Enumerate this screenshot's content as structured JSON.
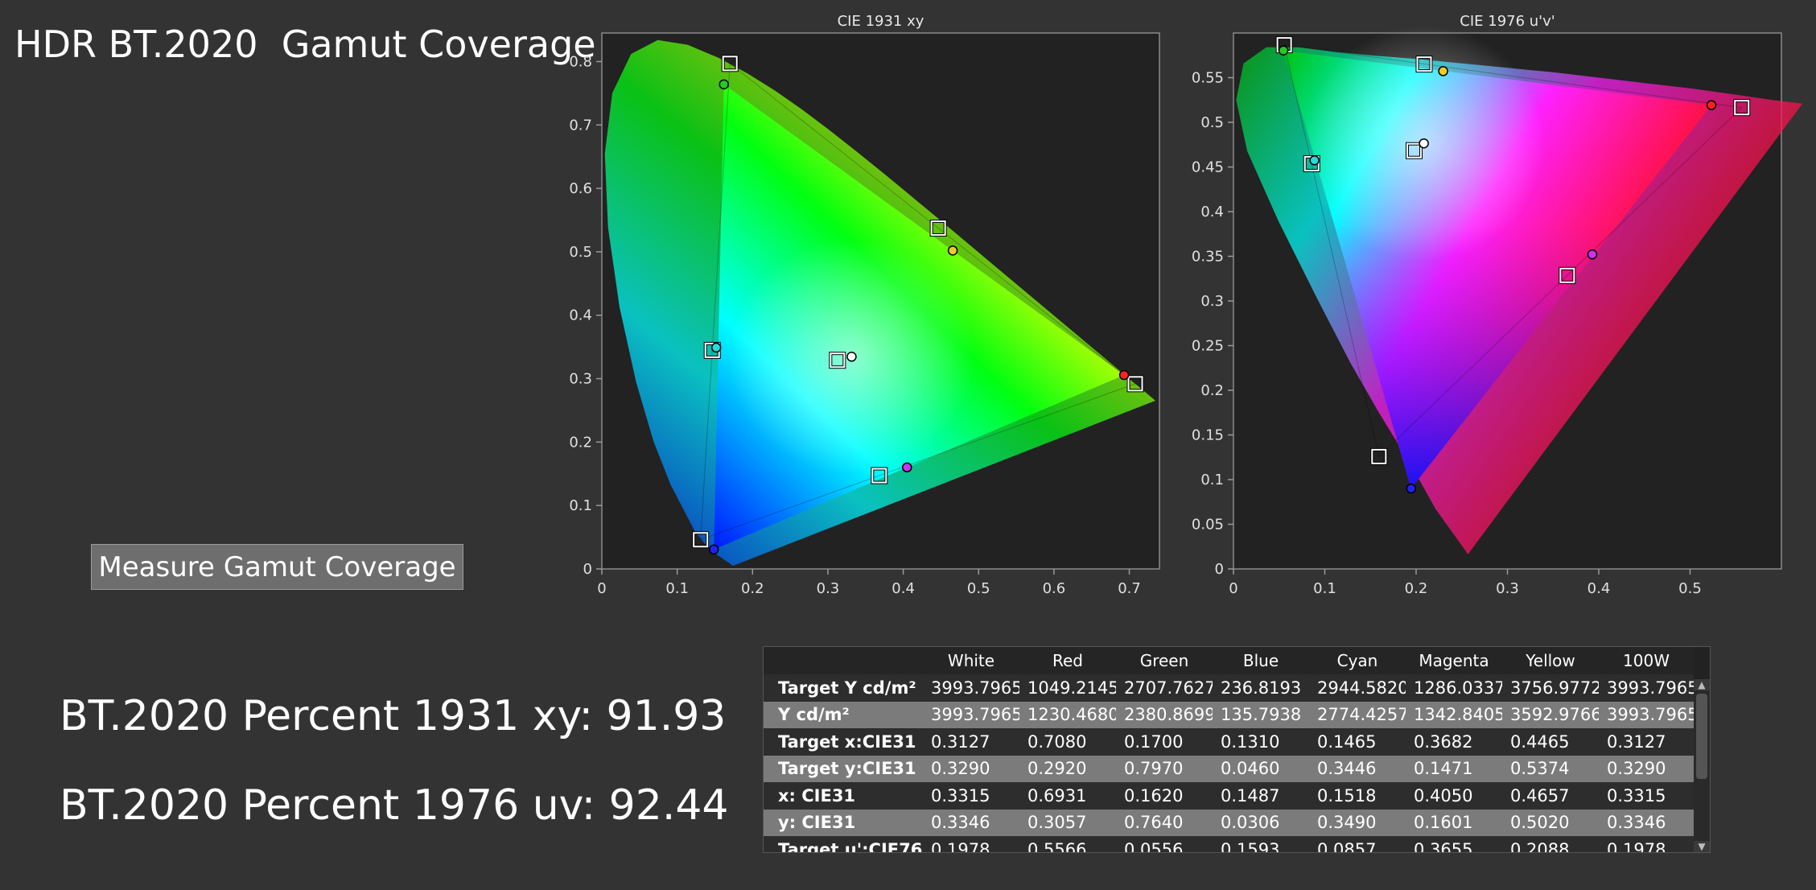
{
  "page_title": "HDR BT.2020  Gamut Coverage",
  "measure_button_label": "Measure Gamut Coverage",
  "stats": {
    "percent_1931": "BT.2020 Percent 1931 xy: 91.93",
    "percent_1976": "BT.2020 Percent 1976 uv: 92.44"
  },
  "colors": {
    "background": "#333333",
    "plot_background": "#222222",
    "table_row_alt": "#7b7b7b"
  },
  "chart_data": [
    {
      "type": "scatter",
      "title": "CIE 1931 xy",
      "xlabel": "",
      "ylabel": "",
      "xlim": [
        0,
        0.74
      ],
      "ylim": [
        0,
        0.845
      ],
      "xticks": [
        0,
        0.1,
        0.2,
        0.3,
        0.4,
        0.5,
        0.6,
        0.7
      ],
      "yticks": [
        0,
        0.1,
        0.2,
        0.3,
        0.4,
        0.5,
        0.6,
        0.7,
        0.8
      ],
      "grid": false,
      "series": [
        {
          "marker": "square",
          "points": [
            {
              "x": 0.3127,
              "y": 0.329
            },
            {
              "x": 0.708,
              "y": 0.292
            },
            {
              "x": 0.17,
              "y": 0.797
            },
            {
              "x": 0.131,
              "y": 0.046
            },
            {
              "x": 0.1465,
              "y": 0.3446
            },
            {
              "x": 0.3682,
              "y": 0.1471
            },
            {
              "x": 0.4465,
              "y": 0.5374
            }
          ]
        },
        {
          "marker": "circle",
          "points": [
            {
              "x": 0.3315,
              "y": 0.3346,
              "color": "#ffffff"
            },
            {
              "x": 0.6931,
              "y": 0.3057,
              "color": "#ff2020"
            },
            {
              "x": 0.162,
              "y": 0.764,
              "color": "#22cc22"
            },
            {
              "x": 0.1487,
              "y": 0.0306,
              "color": "#2222ee"
            },
            {
              "x": 0.1518,
              "y": 0.349,
              "color": "#22dddd"
            },
            {
              "x": 0.405,
              "y": 0.1601,
              "color": "#cc33ee"
            },
            {
              "x": 0.4657,
              "y": 0.502,
              "color": "#eecc22"
            }
          ]
        }
      ]
    },
    {
      "type": "scatter",
      "title": "CIE 1976 u'v'",
      "xlabel": "",
      "ylabel": "",
      "xlim": [
        0,
        0.6
      ],
      "ylim": [
        0,
        0.6
      ],
      "xticks": [
        0,
        0.1,
        0.2,
        0.3,
        0.4,
        0.5
      ],
      "yticks": [
        0,
        0.05,
        0.1,
        0.15,
        0.2,
        0.25,
        0.3,
        0.35,
        0.4,
        0.45,
        0.5,
        0.55
      ],
      "grid": false,
      "series": [
        {
          "marker": "square",
          "points": [
            {
              "x": 0.1978,
              "y": 0.4683
            },
            {
              "x": 0.5566,
              "y": 0.5165
            },
            {
              "x": 0.0556,
              "y": 0.5868
            },
            {
              "x": 0.1593,
              "y": 0.1258
            },
            {
              "x": 0.0857,
              "y": 0.4537
            },
            {
              "x": 0.3655,
              "y": 0.3286
            },
            {
              "x": 0.2088,
              "y": 0.5652
            }
          ]
        },
        {
          "marker": "circle",
          "points": [
            {
              "x": 0.2085,
              "y": 0.4764,
              "color": "#ffffff"
            },
            {
              "x": 0.5234,
              "y": 0.5193,
              "color": "#ff2020"
            },
            {
              "x": 0.0547,
              "y": 0.5804,
              "color": "#22cc22"
            },
            {
              "x": 0.1945,
              "y": 0.09,
              "color": "#2222ee"
            },
            {
              "x": 0.0887,
              "y": 0.4574,
              "color": "#22dddd"
            },
            {
              "x": 0.3929,
              "y": 0.3521,
              "color": "#cc33ee"
            },
            {
              "x": 0.2296,
              "y": 0.5573,
              "color": "#eecc22"
            }
          ]
        }
      ]
    }
  ],
  "table": {
    "columns": [
      "",
      "White",
      "Red",
      "Green",
      "Blue",
      "Cyan",
      "Magenta",
      "Yellow",
      "100W"
    ],
    "rows": [
      [
        "Target Y cd/m²",
        "3993.7965",
        "1049.2145",
        "2707.7627",
        "236.8193",
        "2944.5820",
        "1286.0337",
        "3756.9772",
        "3993.7965"
      ],
      [
        "Y cd/m²",
        "3993.7965",
        "1230.4680",
        "2380.8699",
        "135.7938",
        "2774.4257",
        "1342.8405",
        "3592.9766",
        "3993.7965"
      ],
      [
        "Target x:CIE31",
        "0.3127",
        "0.7080",
        "0.1700",
        "0.1310",
        "0.1465",
        "0.3682",
        "0.4465",
        "0.3127"
      ],
      [
        "Target y:CIE31",
        "0.3290",
        "0.2920",
        "0.7970",
        "0.0460",
        "0.3446",
        "0.1471",
        "0.5374",
        "0.3290"
      ],
      [
        "x: CIE31",
        "0.3315",
        "0.6931",
        "0.1620",
        "0.1487",
        "0.1518",
        "0.4050",
        "0.4657",
        "0.3315"
      ],
      [
        "y: CIE31",
        "0.3346",
        "0.3057",
        "0.7640",
        "0.0306",
        "0.3490",
        "0.1601",
        "0.5020",
        "0.3346"
      ],
      [
        "Target u':CIE76",
        "0.1978",
        "0.5566",
        "0.0556",
        "0.1593",
        "0.0857",
        "0.3655",
        "0.2088",
        "0.1978"
      ]
    ]
  }
}
